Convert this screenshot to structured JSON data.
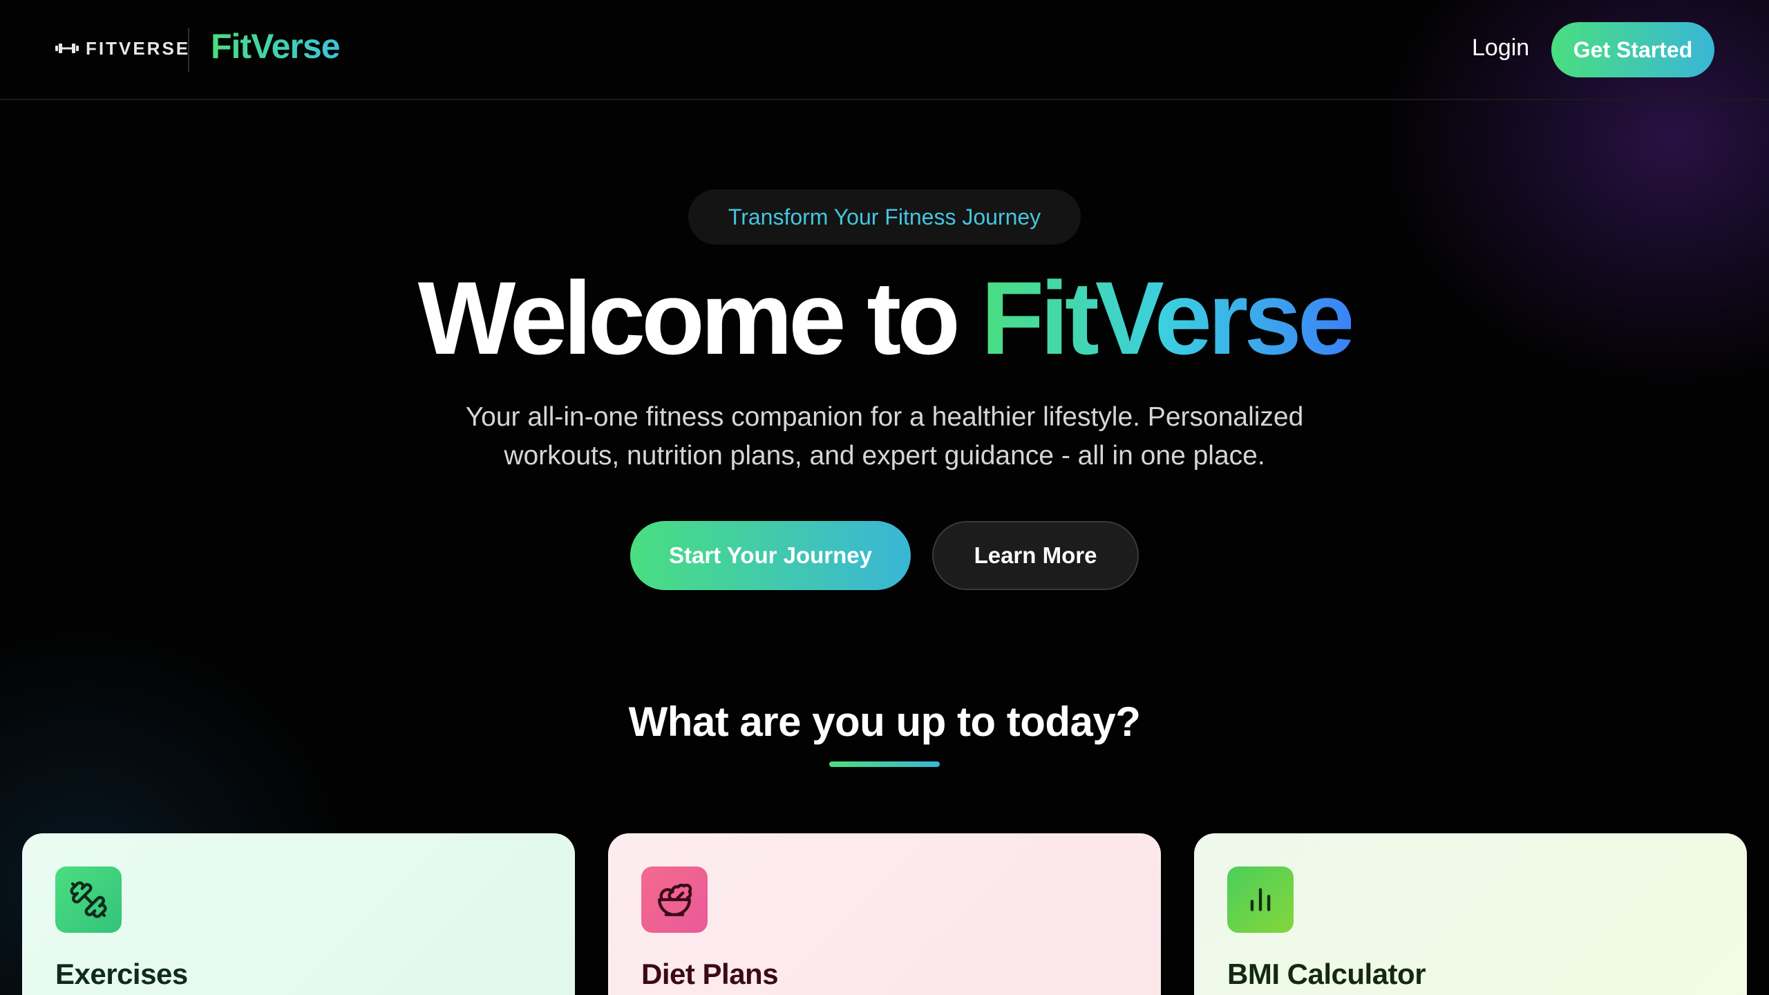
{
  "navbar": {
    "logo_text": "FITVERSE",
    "brand_name": "FitVerse",
    "login_label": "Login",
    "get_started_label": "Get Started"
  },
  "hero": {
    "badge": "Transform Your Fitness Journey",
    "title_prefix": "Welcome to ",
    "title_accent": "FitVerse",
    "subtitle_line1": "Your all-in-one fitness companion for a healthier lifestyle. Personalized",
    "subtitle_line2": "workouts, nutrition plans, and expert guidance - all in one place.",
    "primary_button": "Start Your Journey",
    "secondary_button": "Learn More"
  },
  "section": {
    "heading": "What are you up to today?"
  },
  "cards": [
    {
      "title": "Exercises",
      "icon": "dumbbell-icon"
    },
    {
      "title": "Diet Plans",
      "icon": "salad-bowl-icon"
    },
    {
      "title": "BMI Calculator",
      "icon": "bar-chart-icon"
    }
  ],
  "colors": {
    "accent_green": "#4ade80",
    "accent_cyan": "#3ab6d6",
    "accent_blue": "#3b82f6",
    "background": "#020202"
  }
}
